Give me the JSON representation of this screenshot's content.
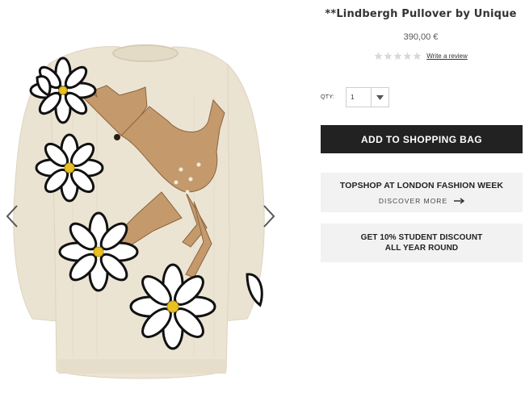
{
  "product": {
    "title": "**Lindbergh Pullover by Unique",
    "price": "390,00 €",
    "rating": {
      "stars_filled": 0,
      "stars_total": 5
    },
    "write_review": "Write a review",
    "image_alt_icon": "sweater-product-image"
  },
  "gallery": {
    "prev_icon": "chevron-left-icon",
    "next_icon": "chevron-right-icon"
  },
  "purchase": {
    "qty_label": "QTY:",
    "qty_value": "1",
    "add_to_bag": "ADD TO SHOPPING BAG"
  },
  "promos": {
    "fashion_week": {
      "title": "TOPSHOP AT LONDON FASHION WEEK",
      "link": "DISCOVER MORE",
      "link_icon": "arrow-right-icon"
    },
    "student": {
      "line1": "GET 10% STUDENT DISCOUNT",
      "line2": "ALL YEAR ROUND"
    }
  },
  "colors": {
    "button_bg": "#222222",
    "promo_bg": "#f2f2f2",
    "star_empty": "#d8d8d8",
    "sweater_cream": "#ece4d3",
    "fawn_tan": "#c49a6c"
  }
}
